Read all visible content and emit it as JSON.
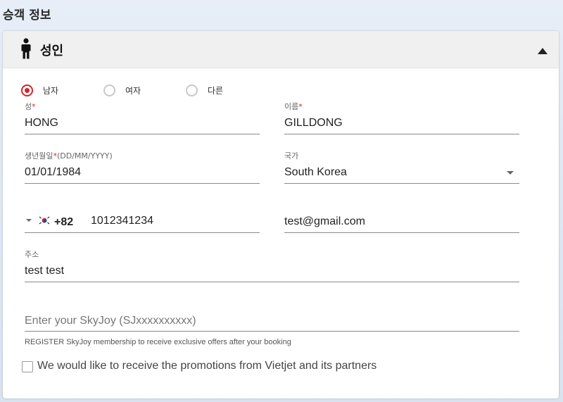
{
  "section": {
    "title": "승객 정보"
  },
  "card": {
    "title": "성인",
    "icons": {
      "person": "person-icon",
      "collapse": "chevron-up-icon"
    }
  },
  "gender": {
    "options": [
      {
        "label": "남자",
        "checked": true
      },
      {
        "label": "여자",
        "checked": false
      },
      {
        "label": "다른",
        "checked": false
      }
    ]
  },
  "fields": {
    "last_name": {
      "label": "성",
      "required": "*",
      "value": "HONG"
    },
    "first_name": {
      "label": "이름",
      "required": "*",
      "value": "GILLDONG"
    },
    "dob": {
      "label_pre": "생년월일",
      "required": "*",
      "label_post": "(DD/MM/YYYY)",
      "value": "01/01/1984"
    },
    "country": {
      "label": "국가",
      "value": "South Korea"
    },
    "phone": {
      "country_code": "+82",
      "flag": "south-korea-flag-icon",
      "value": "1012341234"
    },
    "email": {
      "value": "test@gmail.com"
    },
    "address": {
      "label": "주소",
      "value": "test test"
    },
    "skyjoy": {
      "placeholder": "Enter your SkyJoy (SJxxxxxxxxxx)",
      "hint": "REGISTER SkyJoy membership to receive exclusive offers after your booking"
    }
  },
  "promotions": {
    "label": "We would like to receive the promotions from Vietjet and its partners",
    "checked": false
  },
  "colors": {
    "accent": "#d9232a",
    "header_bg": "#f0f0f0",
    "underline": "#8a8a8a"
  }
}
